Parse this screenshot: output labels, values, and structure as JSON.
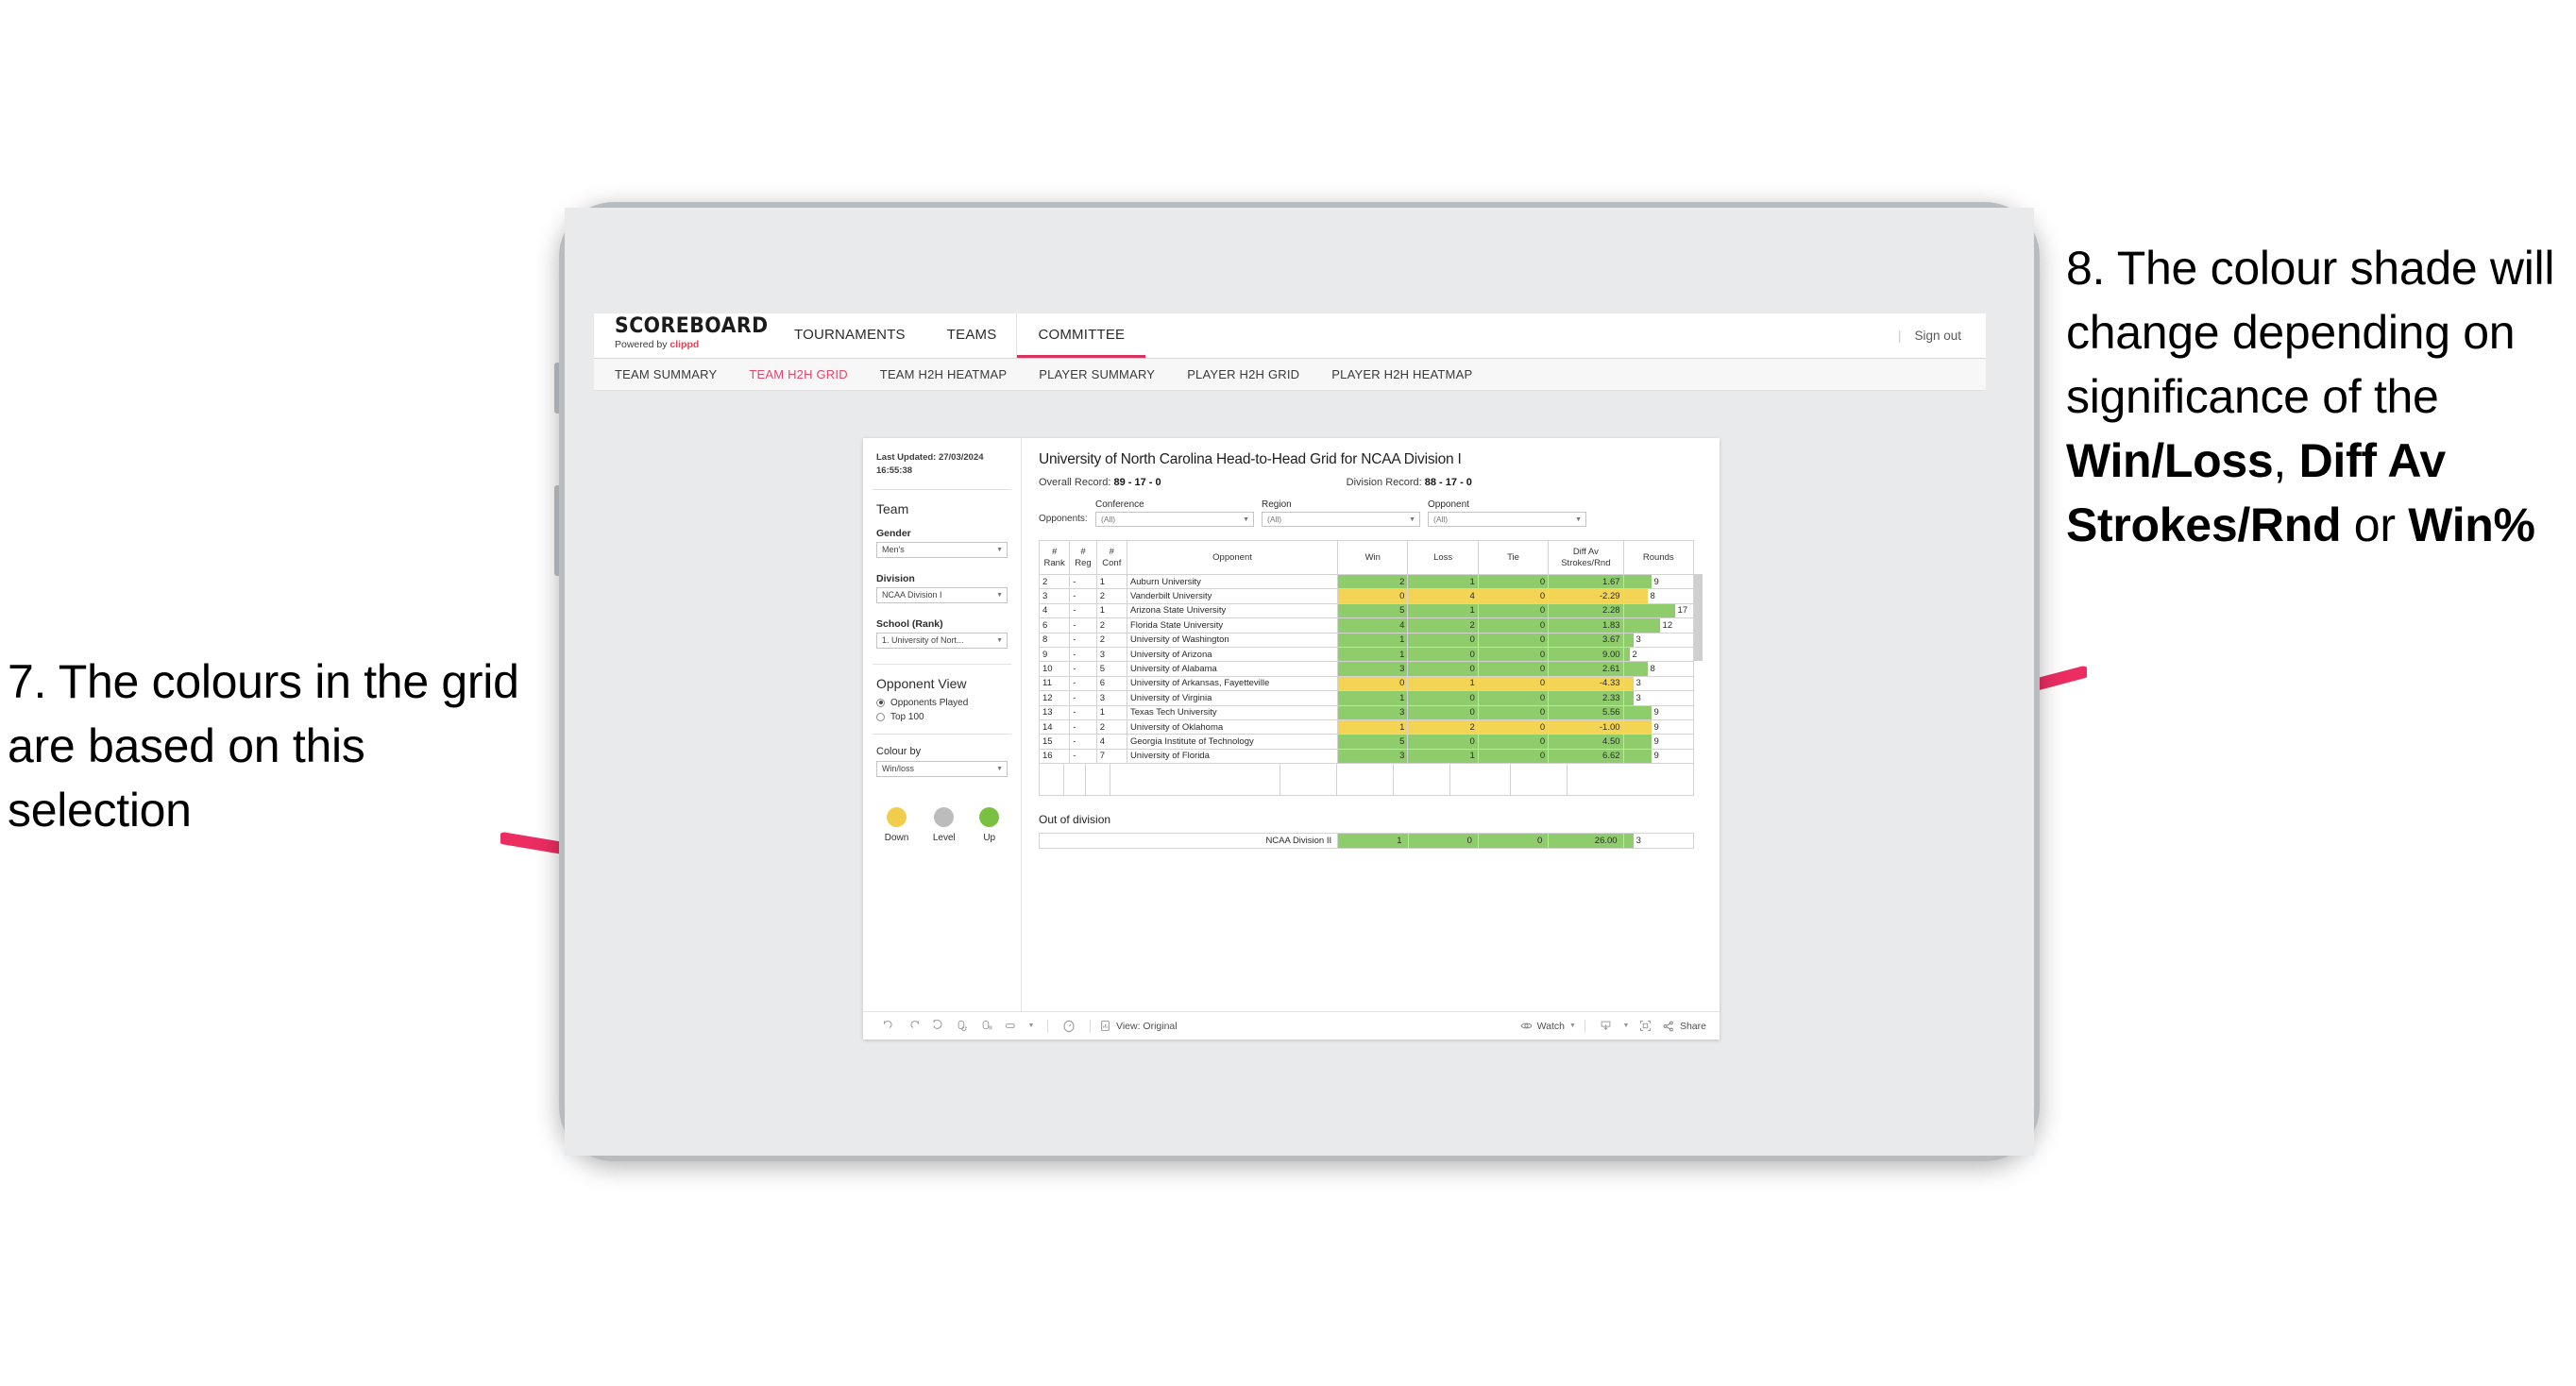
{
  "annotations": {
    "left": {
      "number": "7.",
      "text": "7. The colours in the grid are based on this selection"
    },
    "right": {
      "line1": "8. The colour shade will change depending on significance of the ",
      "bold1": "Win/Loss",
      "mid1": ", ",
      "bold2": "Diff Av Strokes/Rnd",
      "mid2": " or ",
      "bold3": "Win%"
    },
    "arrow_color": "#ec2d62"
  },
  "topbar": {
    "brand_word": "SCOREBOARD",
    "brand_sub_prefix": "Powered by ",
    "brand_sub_accent": "clippd",
    "nav": [
      {
        "label": "TOURNAMENTS",
        "active": false
      },
      {
        "label": "TEAMS",
        "active": false
      },
      {
        "label": "COMMITTEE",
        "active": true
      }
    ],
    "signout_bar": "|",
    "signout_label": "Sign out"
  },
  "subnav": {
    "items": [
      {
        "label": "TEAM SUMMARY",
        "active": false
      },
      {
        "label": "TEAM H2H GRID",
        "active": true
      },
      {
        "label": "TEAM H2H HEATMAP",
        "active": false
      },
      {
        "label": "PLAYER SUMMARY",
        "active": false
      },
      {
        "label": "PLAYER H2H GRID",
        "active": false
      },
      {
        "label": "PLAYER H2H HEATMAP",
        "active": false
      }
    ]
  },
  "sidebar": {
    "last_updated": "Last Updated: 27/03/2024 16:55:38",
    "team_heading": "Team",
    "gender_label": "Gender",
    "gender_value": "Men's",
    "division_label": "Division",
    "division_value": "NCAA Division I",
    "school_label": "School (Rank)",
    "school_value": "1. University of Nort...",
    "opponent_view_heading": "Opponent View",
    "opponent_view_options": [
      {
        "label": "Opponents Played",
        "selected": true
      },
      {
        "label": "Top 100",
        "selected": false
      }
    ],
    "colour_by_label": "Colour by",
    "colour_by_value": "Win/loss",
    "legend": [
      {
        "label": "Down",
        "color": "#f0cd4a"
      },
      {
        "label": "Level",
        "color": "#bcbcbc"
      },
      {
        "label": "Up",
        "color": "#7ac143"
      }
    ]
  },
  "viz": {
    "title": "University of North Carolina Head-to-Head Grid for NCAA Division I",
    "overall_record_label": "Overall Record: ",
    "overall_record_value": "89 - 17 - 0",
    "division_record_label": "Division Record: ",
    "division_record_value": "88 - 17 - 0",
    "opponents_lead": "Opponents:",
    "filters": [
      {
        "label": "Conference",
        "value": "(All)"
      },
      {
        "label": "Region",
        "value": "(All)"
      },
      {
        "label": "Opponent",
        "value": "(All)"
      }
    ],
    "columns": [
      "# Rank",
      "# Reg",
      "# Conf",
      "Opponent",
      "Win",
      "Loss",
      "Tie",
      "Diff Av Strokes/Rnd",
      "Rounds"
    ],
    "column_lines": [
      [
        "#",
        "Rank"
      ],
      [
        "#",
        "Reg"
      ],
      [
        "#",
        "Conf"
      ],
      [
        "Opponent",
        ""
      ],
      [
        "Win",
        ""
      ],
      [
        "Loss",
        ""
      ],
      [
        "Tie",
        ""
      ],
      [
        "Diff Av",
        "Strokes/Rnd"
      ],
      [
        "Rounds",
        ""
      ]
    ],
    "out_of_division_heading": "Out of division"
  },
  "chart_data": {
    "type": "table",
    "title": "University of North Carolina Head-to-Head Grid for NCAA Division I",
    "columns": [
      "# Rank",
      "# Reg",
      "# Conf",
      "Opponent",
      "Win",
      "Loss",
      "Tie",
      "Diff Av Strokes/Rnd",
      "Rounds"
    ],
    "rounds_max": 17,
    "colors": {
      "up": "#8fcc6b",
      "down": "#f3d454",
      "level": "#bcbcbc"
    },
    "rows": [
      {
        "rank": "2",
        "reg": "-",
        "conf": "1",
        "opponent": "Auburn University",
        "win": "2",
        "loss": "1",
        "tie": "0",
        "diff": "1.67",
        "rounds": "9",
        "rounds_val": 9,
        "state": "up"
      },
      {
        "rank": "3",
        "reg": "-",
        "conf": "2",
        "opponent": "Vanderbilt University",
        "win": "0",
        "loss": "4",
        "tie": "0",
        "diff": "-2.29",
        "rounds": "8",
        "rounds_val": 8,
        "state": "down"
      },
      {
        "rank": "4",
        "reg": "-",
        "conf": "1",
        "opponent": "Arizona State University",
        "win": "5",
        "loss": "1",
        "tie": "0",
        "diff": "2.28",
        "rounds": "17",
        "rounds_val": 17,
        "state": "up"
      },
      {
        "rank": "6",
        "reg": "-",
        "conf": "2",
        "opponent": "Florida State University",
        "win": "4",
        "loss": "2",
        "tie": "0",
        "diff": "1.83",
        "rounds": "12",
        "rounds_val": 12,
        "state": "up"
      },
      {
        "rank": "8",
        "reg": "-",
        "conf": "2",
        "opponent": "University of Washington",
        "win": "1",
        "loss": "0",
        "tie": "0",
        "diff": "3.67",
        "rounds": "3",
        "rounds_val": 3,
        "state": "up"
      },
      {
        "rank": "9",
        "reg": "-",
        "conf": "3",
        "opponent": "University of Arizona",
        "win": "1",
        "loss": "0",
        "tie": "0",
        "diff": "9.00",
        "rounds": "2",
        "rounds_val": 2,
        "state": "up"
      },
      {
        "rank": "10",
        "reg": "-",
        "conf": "5",
        "opponent": "University of Alabama",
        "win": "3",
        "loss": "0",
        "tie": "0",
        "diff": "2.61",
        "rounds": "8",
        "rounds_val": 8,
        "state": "up"
      },
      {
        "rank": "11",
        "reg": "-",
        "conf": "6",
        "opponent": "University of Arkansas, Fayetteville",
        "win": "0",
        "loss": "1",
        "tie": "0",
        "diff": "-4.33",
        "rounds": "3",
        "rounds_val": 3,
        "state": "down"
      },
      {
        "rank": "12",
        "reg": "-",
        "conf": "3",
        "opponent": "University of Virginia",
        "win": "1",
        "loss": "0",
        "tie": "0",
        "diff": "2.33",
        "rounds": "3",
        "rounds_val": 3,
        "state": "up"
      },
      {
        "rank": "13",
        "reg": "-",
        "conf": "1",
        "opponent": "Texas Tech University",
        "win": "3",
        "loss": "0",
        "tie": "0",
        "diff": "5.56",
        "rounds": "9",
        "rounds_val": 9,
        "state": "up"
      },
      {
        "rank": "14",
        "reg": "-",
        "conf": "2",
        "opponent": "University of Oklahoma",
        "win": "1",
        "loss": "2",
        "tie": "0",
        "diff": "-1.00",
        "rounds": "9",
        "rounds_val": 9,
        "state": "down"
      },
      {
        "rank": "15",
        "reg": "-",
        "conf": "4",
        "opponent": "Georgia Institute of Technology",
        "win": "5",
        "loss": "0",
        "tie": "0",
        "diff": "4.50",
        "rounds": "9",
        "rounds_val": 9,
        "state": "up"
      },
      {
        "rank": "16",
        "reg": "-",
        "conf": "7",
        "opponent": "University of Florida",
        "win": "3",
        "loss": "1",
        "tie": "0",
        "diff": "6.62",
        "rounds": "9",
        "rounds_val": 9,
        "state": "up"
      }
    ],
    "out_of_division": [
      {
        "opponent": "NCAA Division II",
        "win": "1",
        "loss": "0",
        "tie": "0",
        "diff": "26.00",
        "rounds": "3",
        "rounds_val": 3,
        "state": "up"
      }
    ]
  },
  "toolbar": {
    "view_label": "View: Original",
    "watch_label": "Watch",
    "share_label": "Share"
  }
}
